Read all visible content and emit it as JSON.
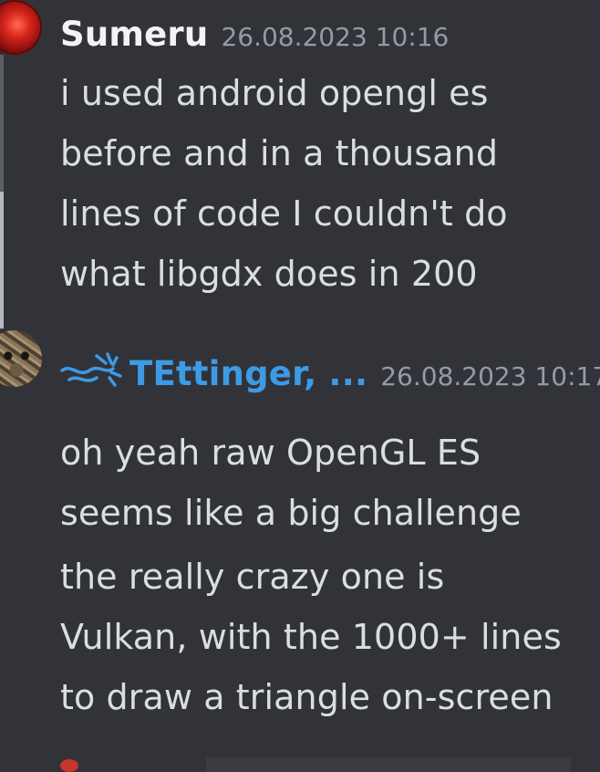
{
  "messages": [
    {
      "author": "Sumeru",
      "timestamp": "26.08.2023 10:16",
      "avatar_icon": "red-orb-avatar",
      "lines": [
        "i used android opengl es",
        "before and in a thousand",
        "lines of code I couldn't do",
        "what libgdx does in 200"
      ]
    },
    {
      "author": "TEttinger, ...",
      "timestamp": "26.08.2023 10:17",
      "avatar_icon": "cat-avatar",
      "author_color": "#3d9ae6",
      "lines": [
        "oh yeah raw OpenGL ES",
        "seems like a big challenge",
        "the really crazy one is",
        "Vulkan, with the 1000+ lines",
        "to draw a triangle on-screen"
      ]
    }
  ]
}
